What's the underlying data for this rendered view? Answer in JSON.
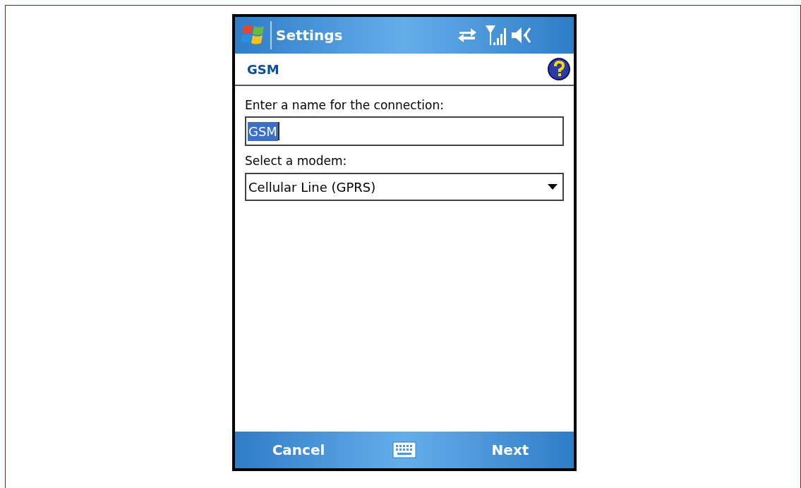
{
  "title_bar": {
    "title": "Settings"
  },
  "header": {
    "title": "GSM"
  },
  "form": {
    "name_label": "Enter a name for the connection:",
    "name_value": "GSM",
    "name_text_selected": true,
    "modem_label": "Select a modem:",
    "modem_value": "Cellular Line (GPRS)"
  },
  "softkeys": {
    "left": "Cancel",
    "right": "Next"
  }
}
